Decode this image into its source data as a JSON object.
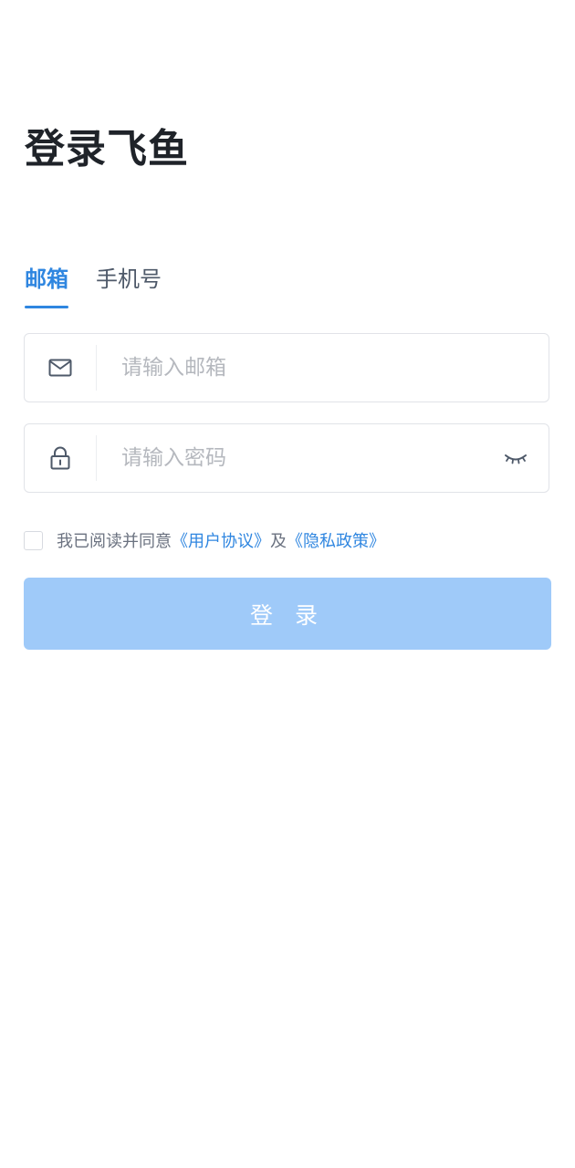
{
  "title": "登录飞鱼",
  "tabs": [
    {
      "label": "邮箱",
      "active": true
    },
    {
      "label": "手机号",
      "active": false
    }
  ],
  "email_field": {
    "icon": "mail-icon",
    "placeholder": "请输入邮箱",
    "value": ""
  },
  "password_field": {
    "icon": "lock-icon",
    "placeholder": "请输入密码",
    "value": "",
    "toggle_icon": "eye-closed-icon"
  },
  "agreement": {
    "prefix": "我已阅读并同意",
    "user_agreement": "《用户协议》",
    "conjunction": "及",
    "privacy_policy": "《隐私政策》",
    "checked": false
  },
  "login_button": {
    "label": "登 录"
  },
  "colors": {
    "accent": "#2f86e0",
    "button_disabled": "#9fcaf9",
    "border": "#e1e3e8",
    "placeholder": "#b5b8be"
  }
}
